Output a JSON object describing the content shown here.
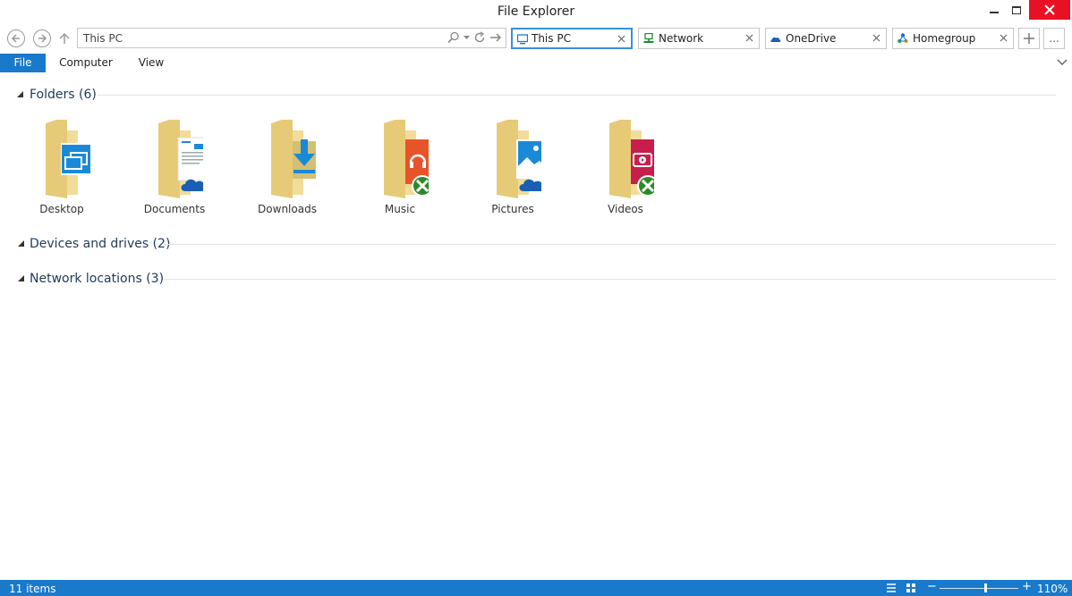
{
  "window": {
    "title": "File Explorer"
  },
  "address": {
    "path": "This PC"
  },
  "tabs": [
    {
      "label": "This PC",
      "icon": "monitor-icon",
      "active": true
    },
    {
      "label": "Network",
      "icon": "network-icon",
      "active": false
    },
    {
      "label": "OneDrive",
      "icon": "onedrive-icon",
      "active": false
    },
    {
      "label": "Homegroup",
      "icon": "homegroup-icon",
      "active": false
    }
  ],
  "more_tabs_label": "...",
  "ribbon": {
    "file": "File",
    "computer": "Computer",
    "view": "View"
  },
  "groups": {
    "folders": "Folders (6)",
    "devices": "Devices and drives (2)",
    "network": "Network locations (3)"
  },
  "folders": [
    {
      "label": "Desktop",
      "overlay": "desktop-icon"
    },
    {
      "label": "Documents",
      "overlay": "document-onedrive-icon"
    },
    {
      "label": "Downloads",
      "overlay": "download-arrow-icon"
    },
    {
      "label": "Music",
      "overlay": "music-xbox-icon"
    },
    {
      "label": "Pictures",
      "overlay": "picture-onedrive-icon"
    },
    {
      "label": "Videos",
      "overlay": "video-xbox-icon"
    }
  ],
  "status": {
    "items": "11 items",
    "zoom": "110%"
  },
  "colors": {
    "accent": "#1979ca",
    "close": "#e81123",
    "folder": "#efd98f",
    "active_tab_border": "#3c8fd8"
  }
}
